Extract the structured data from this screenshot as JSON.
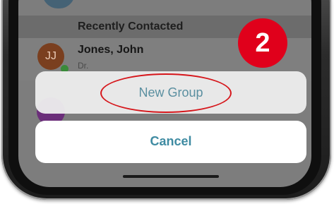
{
  "section_header": {
    "label": "Recently Contacted"
  },
  "contact": {
    "initials": "JJ",
    "name": "Jones, John",
    "subtitle": "Dr."
  },
  "action_sheet": {
    "new_group_label": "New Group",
    "cancel_label": "Cancel"
  },
  "annotation": {
    "step_number": "2"
  },
  "colors": {
    "annotation_red": "#e0001b",
    "action_text": "#5a8fa0",
    "cancel_text": "#3f8ba2",
    "avatar_brown": "#7a3f1f",
    "avatar_purple": "#6b2e7a"
  }
}
